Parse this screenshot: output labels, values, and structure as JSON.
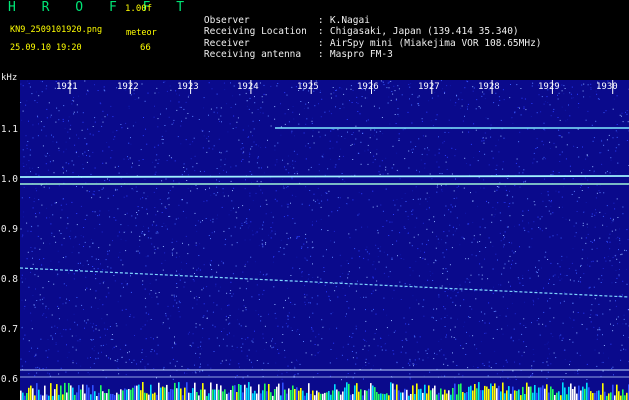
{
  "header": {
    "title": "H R O F F T",
    "version": "1.00f",
    "filename": "KN9_2509101920.png",
    "meteor_label": "meteor",
    "datetime": "25.09.10 19:20",
    "meteor_count": "66"
  },
  "info": [
    {
      "key": "Observer",
      "value": "K.Nagai"
    },
    {
      "key": "Receiving Location",
      "value": "Chigasaki, Japan (139.414 35.340)"
    },
    {
      "key": "Receiver",
      "value": "AirSpy mini (Miakejima VOR 108.65MHz)"
    },
    {
      "key": "Receiving antenna",
      "value": "Maspro FM-3"
    }
  ],
  "axis": {
    "y_unit": "kHz",
    "y_ticks": [
      "1.1",
      "1.0",
      "0.9",
      "0.8",
      "0.7",
      "0.6"
    ],
    "x_ticks": [
      "1921",
      "1922",
      "1923",
      "1924",
      "1925",
      "1926",
      "1927",
      "1928",
      "1929",
      "1930"
    ]
  },
  "colors": {
    "background": "#000000",
    "spectrum_base": "#0a0a8c",
    "signal": "#7fe8ff",
    "title": "#00e676",
    "accent": "#ffff00"
  }
}
